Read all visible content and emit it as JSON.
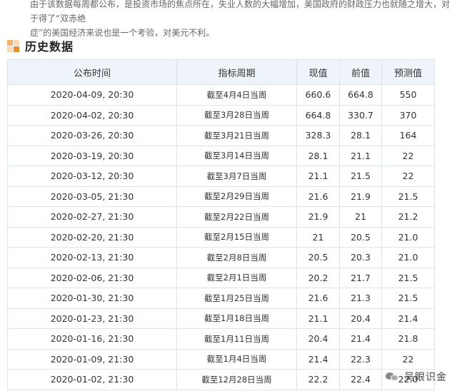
{
  "intro": {
    "line1": "由于该数据每周都公布，是投资市场的焦点所在，失业人数的大幅增加，美国政府的财政压力也就随之增大，对于得了“双赤绝",
    "line2": "症”的美国经济来说也是一个考验，对美元不利。"
  },
  "section": {
    "title": "历史数据"
  },
  "table": {
    "headers": [
      "公布时间",
      "指标周期",
      "现值",
      "前值",
      "预测值"
    ],
    "rows": [
      [
        "2020-04-09, 20:30",
        "截至4月4日当周",
        "660.6",
        "664.8",
        "550"
      ],
      [
        "2020-04-02, 20:30",
        "截至3月28日当周",
        "664.8",
        "330.7",
        "370"
      ],
      [
        "2020-03-26, 20:30",
        "截至3月21日当周",
        "328.3",
        "28.1",
        "164"
      ],
      [
        "2020-03-19, 20:30",
        "截至3月14日当周",
        "28.1",
        "21.1",
        "22"
      ],
      [
        "2020-03-12, 20:30",
        "截至3月7日当周",
        "21.1",
        "21.5",
        "22"
      ],
      [
        "2020-03-05, 21:30",
        "截至2月29日当周",
        "21.6",
        "21.9",
        "21.5"
      ],
      [
        "2020-02-27, 21:30",
        "截至2月22日当周",
        "21.9",
        "21",
        "21.2"
      ],
      [
        "2020-02-20, 21:30",
        "截至2月15日当周",
        "21",
        "20.5",
        "21.0"
      ],
      [
        "2020-02-13, 21:30",
        "截至2月8日当周",
        "20.5",
        "20.3",
        "21.0"
      ],
      [
        "2020-02-06, 21:30",
        "截至2月1日当周",
        "20.2",
        "21.7",
        "21.5"
      ],
      [
        "2020-01-30, 21:30",
        "截至1月25日当周",
        "21.6",
        "21.3",
        "21.5"
      ],
      [
        "2020-01-23, 21:30",
        "截至1月18日当周",
        "21.1",
        "20.4",
        "21.4"
      ],
      [
        "2020-01-16, 21:30",
        "截至1月11日当周",
        "20.4",
        "21.4",
        "21.8"
      ],
      [
        "2020-01-09, 21:30",
        "截至1月4日当周",
        "21.4",
        "22.3",
        "22"
      ],
      [
        "2020-01-02, 21:30",
        "截至12月28日当周",
        "22.2",
        "22.4",
        "22.0"
      ]
    ]
  },
  "watermark": {
    "text": "吴眼识金",
    "icon": "wechat-icon"
  }
}
